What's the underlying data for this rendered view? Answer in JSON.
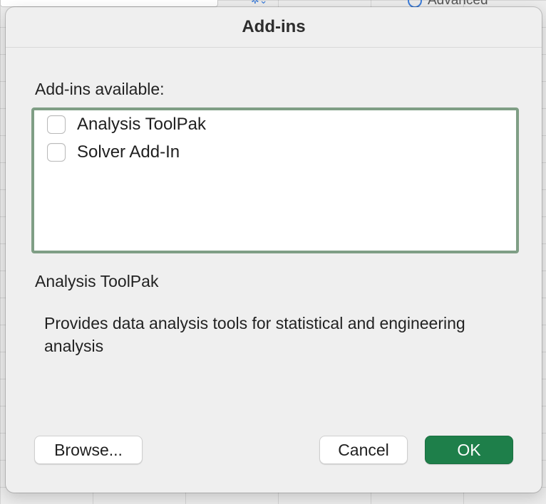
{
  "background": {
    "advanced_label": "Advanced",
    "accent_color": "#3b7bd8"
  },
  "dialog": {
    "title": "Add-ins",
    "available_label": "Add-ins available:",
    "addins": [
      {
        "label": "Analysis ToolPak",
        "checked": false
      },
      {
        "label": "Solver Add-In",
        "checked": false
      }
    ],
    "selected": {
      "name": "Analysis ToolPak",
      "description": "Provides data analysis tools for statistical and engineering analysis"
    },
    "buttons": {
      "browse": "Browse...",
      "cancel": "Cancel",
      "ok": "OK"
    },
    "colors": {
      "list_border": "#7f9e85",
      "ok_button": "#1e7f4a"
    }
  }
}
